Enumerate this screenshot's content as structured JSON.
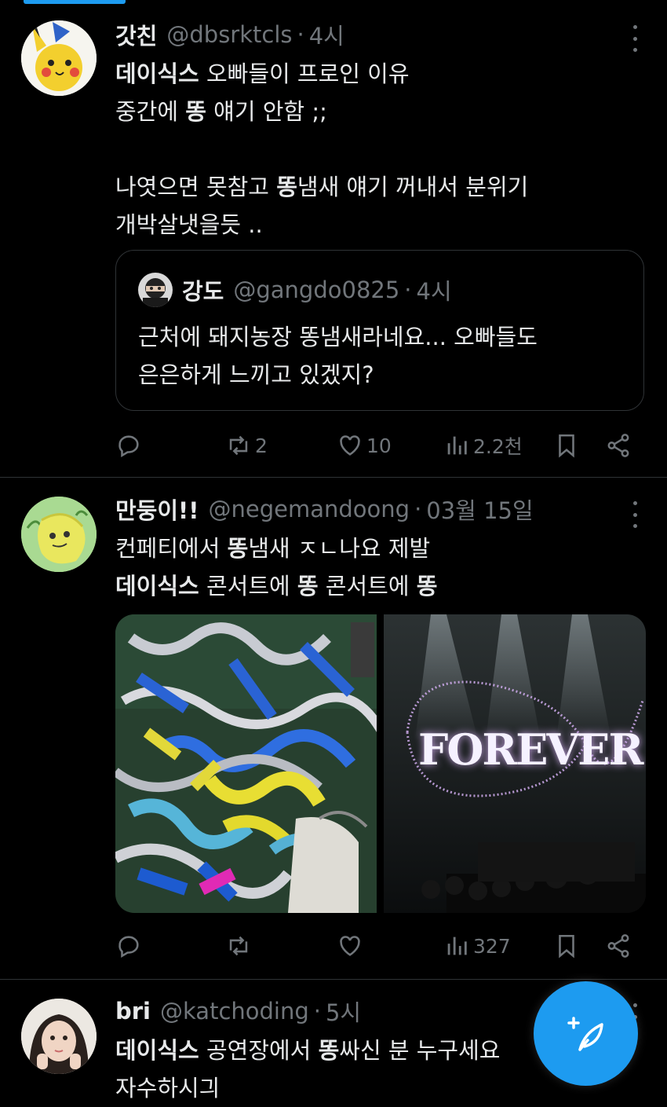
{
  "tweets": [
    {
      "name": "갓친",
      "handle": "@dbsrktcls",
      "time": "4시",
      "text_bold1": "데이식스",
      "text_line1": " 오빠들이 프로인 이유",
      "text_line2a": "중간에 ",
      "text_bold2": "똥",
      "text_line2b": " 얘기 안함 ;;",
      "text_line3a": "나엿으면 못참고 ",
      "text_bold3": "똥",
      "text_line3b": "냄새 얘기 꺼내서 분위기",
      "text_line4": "개박살냇을듯 ..",
      "quote": {
        "name": "강도",
        "handle": "@gangdo0825",
        "time": "4시",
        "line1": "근처에 돼지농장 똥냄새라네요... 오빠들도",
        "line2": "은은하게 느끼고 있겠지?"
      },
      "stats": {
        "replies": "",
        "retweets": "2",
        "likes": "10",
        "views": "2.2천"
      }
    },
    {
      "name": "만둥이!!",
      "handle": "@negemandoong",
      "time": "03월 15일",
      "line1a": "컨페티에서 ",
      "line1bold": "똥",
      "line1b": "냄새 ㅈㄴ나요 제발",
      "line2bold1": "데이식스",
      "line2a": " 콘서트에 ",
      "line2bold2": "똥",
      "line2b": " 콘서트에 ",
      "line2bold3": "똥",
      "image_text": "FOREVER",
      "stats": {
        "replies": "",
        "retweets": "",
        "likes": "",
        "views": "327"
      }
    },
    {
      "name": "bri",
      "handle": "@katchoding",
      "time": "5시",
      "line1bold1": "데이식스",
      "line1a": " 공연장에서 ",
      "line1bold2": "똥",
      "line1b": "싸신 분 누구세요",
      "line2": "자수하시긔"
    }
  ],
  "colors": {
    "accent": "#1d9bf0",
    "muted": "#71767b",
    "text": "#e7e9ea",
    "divider": "#2f3336"
  },
  "icons": [
    "reply-icon",
    "retweet-icon",
    "like-icon",
    "views-icon",
    "bookmark-icon",
    "share-icon",
    "more-icon",
    "compose-icon"
  ]
}
